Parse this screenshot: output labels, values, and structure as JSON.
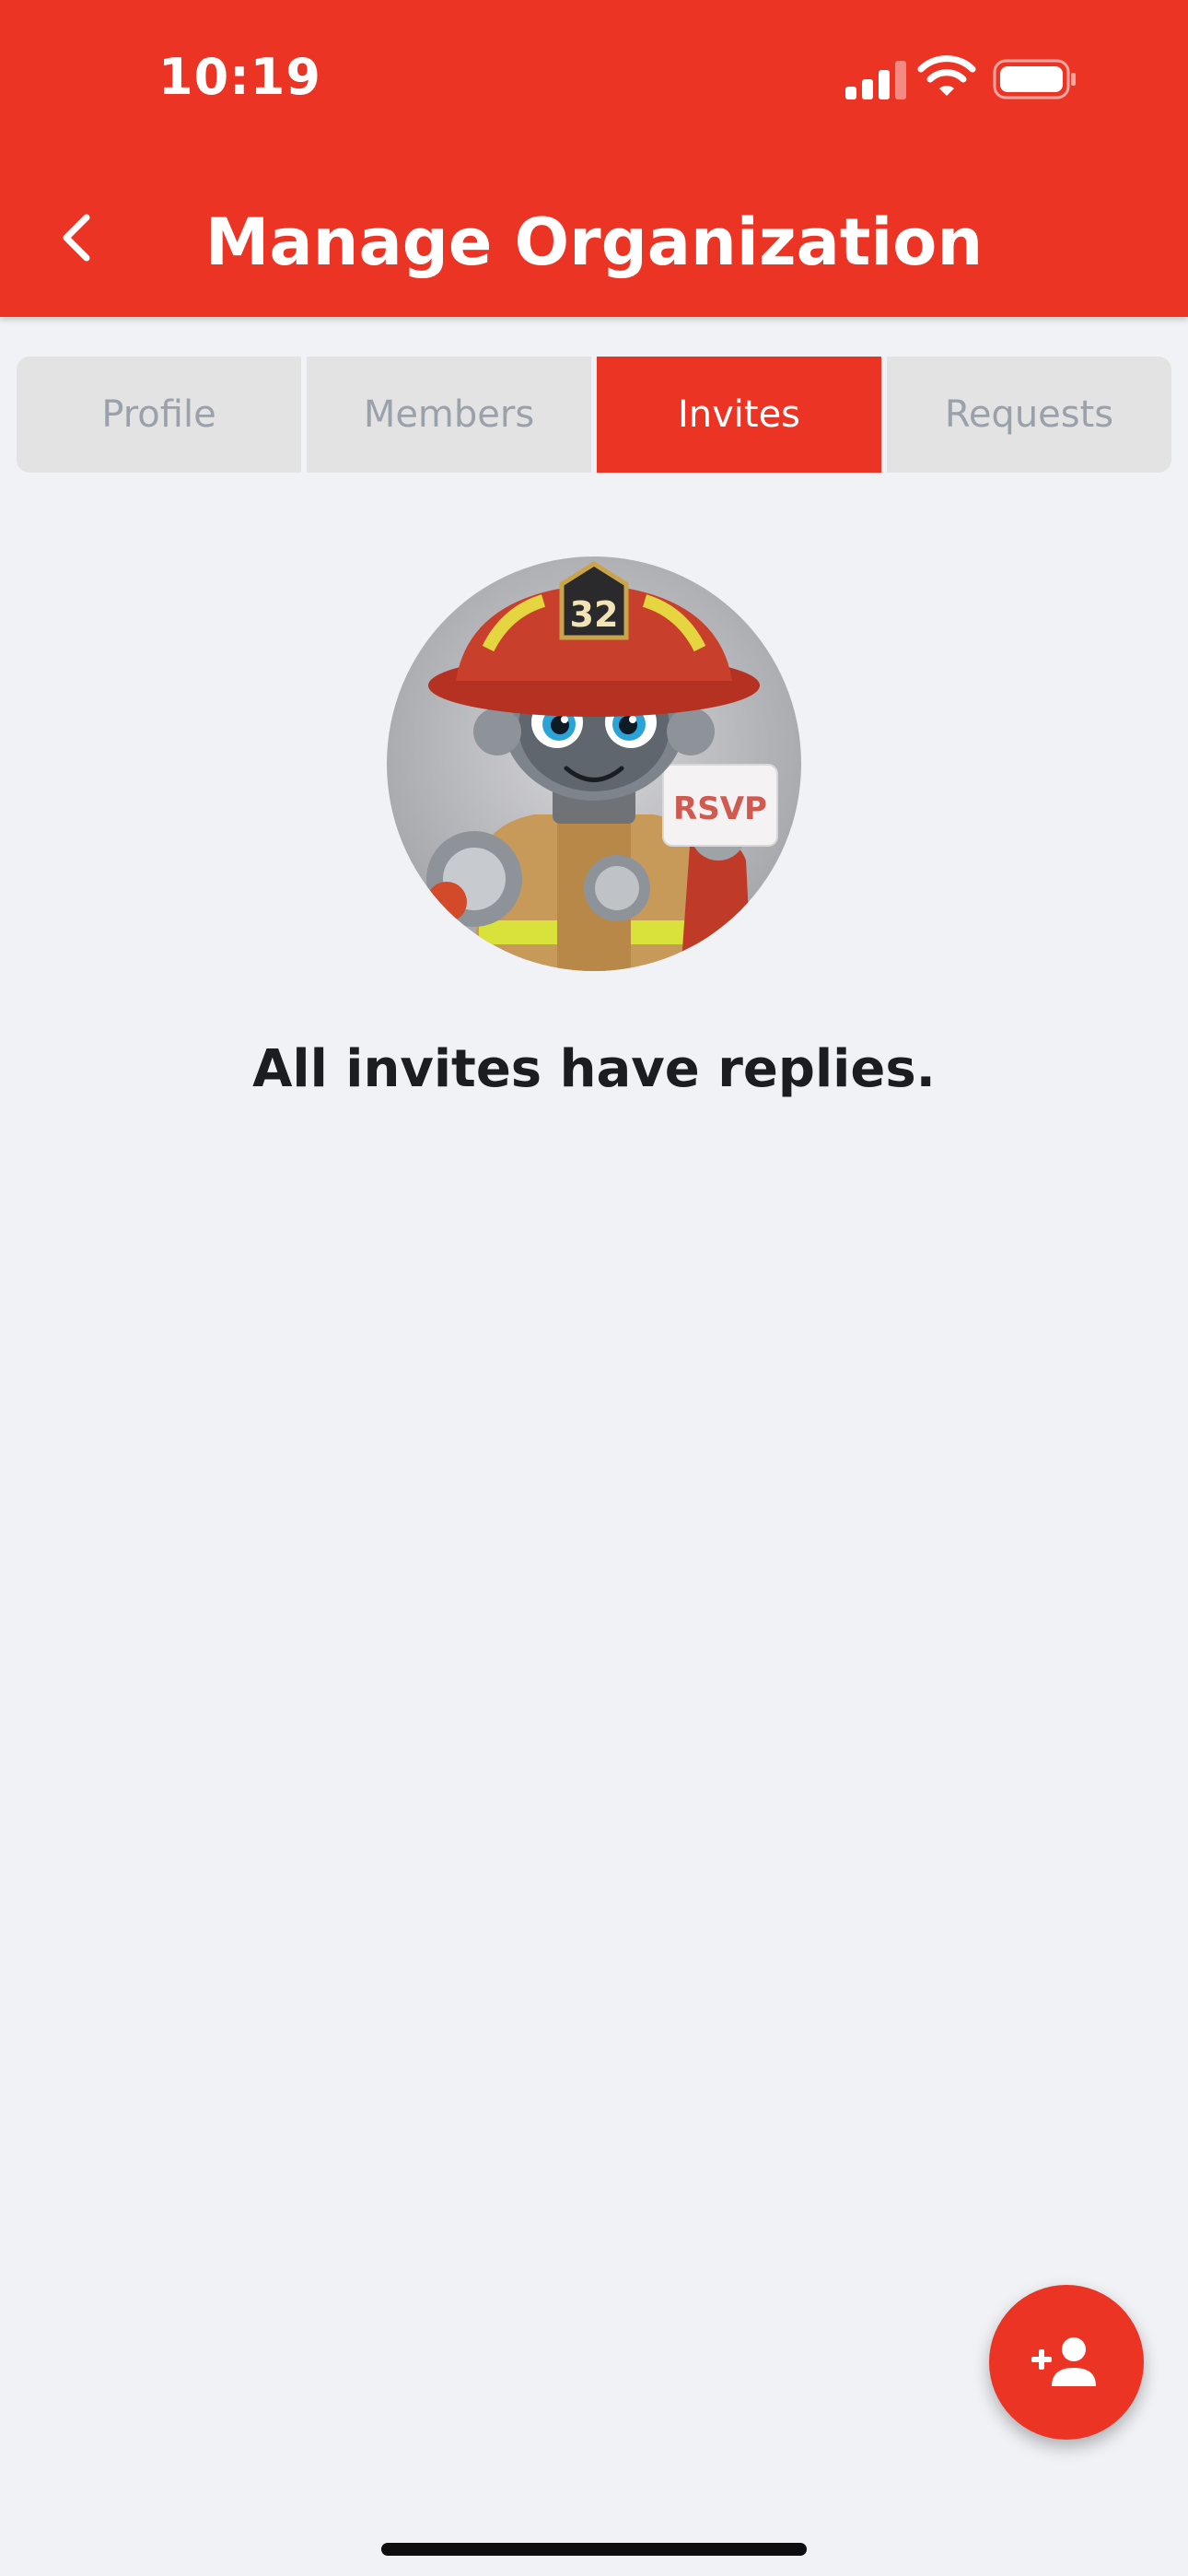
{
  "status_bar": {
    "time": "10:19",
    "icons": [
      "cellular-signal-icon",
      "wifi-icon",
      "battery-icon"
    ]
  },
  "header": {
    "title": "Manage Organization",
    "back_icon": "chevron-left-icon",
    "background_color": "#EC3425"
  },
  "tabs": [
    {
      "label": "Profile",
      "active": false
    },
    {
      "label": "Members",
      "active": false
    },
    {
      "label": "Invites",
      "active": true
    },
    {
      "label": "Requests",
      "active": false
    }
  ],
  "empty_state": {
    "illustration": {
      "helmet_number": "32",
      "card_text": "RSVP"
    },
    "message": "All invites have replies."
  },
  "fab": {
    "icon": "add-person-icon"
  },
  "colors": {
    "accent": "#EC3425",
    "background": "#F0F2F6",
    "tab_inactive_bg": "#E3E3E3",
    "tab_inactive_text": "#9AA1AA"
  }
}
